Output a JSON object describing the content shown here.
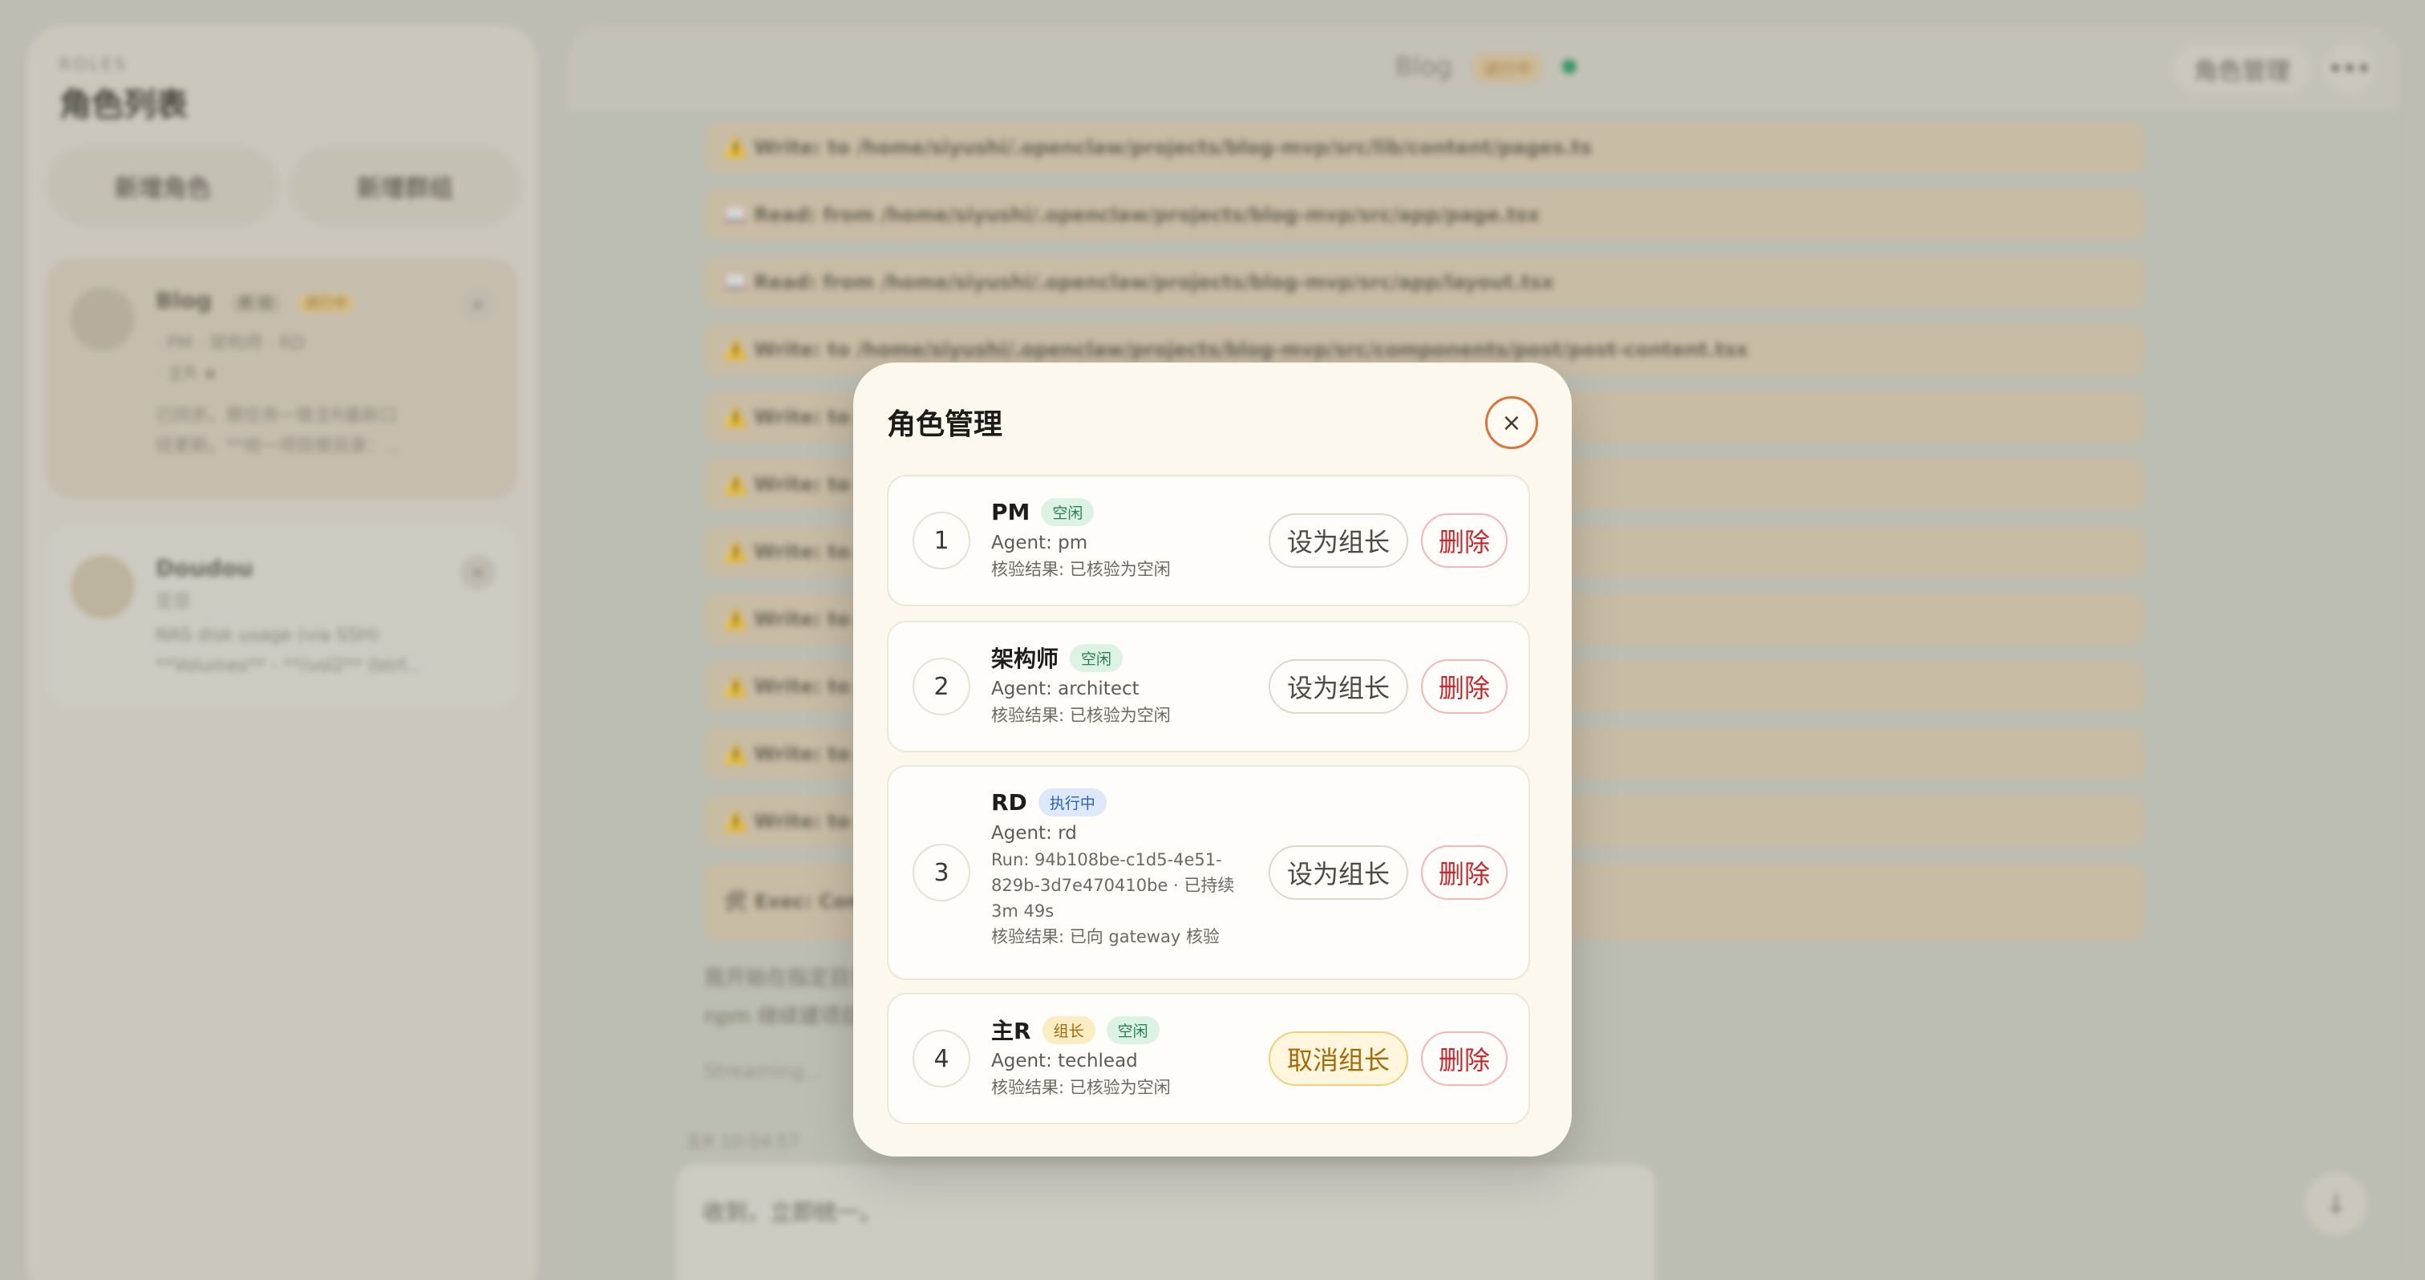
{
  "sidebar": {
    "eyebrow": "ROLES",
    "title": "角色列表",
    "add_role_label": "新增角色",
    "add_group_label": "新增群组",
    "cards": [
      {
        "name": "Blog",
        "tag": "群 组",
        "status": "进行中",
        "members": "· PM  · 架构师  · RD",
        "members2": "· 主R ★",
        "preview1": "已同步。跟任务一致主R最新口",
        "preview2": "径更新。**统一项目根目录：..."
      },
      {
        "name": "Doudou",
        "tag": "豆豆",
        "preview1": "NAS disk usage (via SSH)",
        "preview2": "**Volumes** - **/vol2** (btrf..."
      }
    ]
  },
  "main": {
    "header": {
      "title": "Blog",
      "status": "进行中",
      "status_color": "#2f9e62",
      "role_button_label": "角色管理",
      "more_label": "•••"
    },
    "log_rows": [
      "⚠️ Write: to /home/siyushi/.openclaw/projects/blog-mvp/src/lib/content/pages.ts",
      "📖 Read: from /home/siyushi/.openclaw/projects/blog-mvp/src/app/page.tsx",
      "📖 Read: from /home/siyushi/.openclaw/projects/blog-mvp/src/app/layout.tsx",
      "⚠️ Write: to /home/siyushi/.openclaw/projects/blog-mvp/src/components/post/post-content.tsx",
      "⚠️ Write: to /h",
      "⚠️ Write: to /h",
      "⚠️ Write: to /h",
      "⚠️ Write: to /h",
      "⚠️ Write: to /h",
      "⚠️ Write: to /h",
      "⚠️ Write: to /h"
    ],
    "exec_row": "🛠 Exec: Comm",
    "paragraph1": "我开始在指定目录完成。初始化被环境卡住：机器上没有 pnpm，我改用",
    "paragraph2": "npm 继续建项目。down 依赖、内容层和首页/详情页/not-found。",
    "streaming_label": "Streaming...",
    "timestamp": "主R  10:04:57",
    "reply_text": "收到，立即统一。"
  },
  "modal": {
    "title": "角色管理",
    "close_label": "×",
    "roles": [
      {
        "index": "1",
        "name": "PM",
        "status": "空闲",
        "agent": "Agent: pm",
        "result": "核验结果: 已核验为空闲",
        "lead_label": "设为组长",
        "delete_label": "删除"
      },
      {
        "index": "2",
        "name": "架构师",
        "status": "空闲",
        "agent": "Agent: architect",
        "result": "核验结果: 已核验为空闲",
        "lead_label": "设为组长",
        "delete_label": "删除"
      },
      {
        "index": "3",
        "name": "RD",
        "status": "执行中",
        "agent": "Agent: rd",
        "run_line1": "Run: 94b108be-c1d5-4e51-",
        "run_line2": "829b-3d7e470410be · 已持续",
        "run_line3": "3m 49s",
        "result": "核验结果: 已向 gateway 核验",
        "lead_label": "设为组长",
        "delete_label": "删除"
      },
      {
        "index": "4",
        "name": "主R",
        "lead_badge": "组长",
        "status": "空闲",
        "agent": "Agent: techlead",
        "result": "核验结果: 已核验为空闲",
        "lead_label": "取消组长",
        "delete_label": "删除"
      }
    ]
  }
}
